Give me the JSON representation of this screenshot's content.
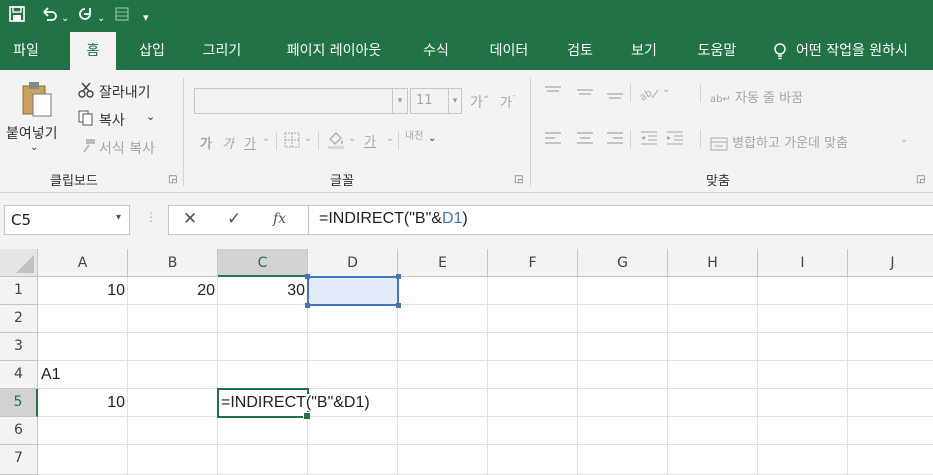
{
  "qat": {
    "save_icon": "save-icon",
    "undo_icon": "undo-icon",
    "redo_icon": "redo-icon",
    "form_icon": "form-icon",
    "customize_icon": "customize-icon"
  },
  "tabs": [
    {
      "label": "파일"
    },
    {
      "label": "홈",
      "active": true
    },
    {
      "label": "삽입"
    },
    {
      "label": "그리기"
    },
    {
      "label": "페이지 레이아웃"
    },
    {
      "label": "수식"
    },
    {
      "label": "데이터"
    },
    {
      "label": "검토"
    },
    {
      "label": "보기"
    },
    {
      "label": "도움말"
    }
  ],
  "tell_me": {
    "placeholder": "어떤 작업을 원하시"
  },
  "clipboard": {
    "paste": "붙여넣기",
    "cut": "잘라내기",
    "copy": "복사",
    "format_painter": "서식 복사",
    "group": "클립보드"
  },
  "font": {
    "font_size": "11",
    "increase": "가",
    "decrease": "가",
    "bold": "가",
    "italic": "가",
    "underline": "가",
    "font_color": "가",
    "phonetic": "내천",
    "group": "글꼴"
  },
  "alignment": {
    "wrap_text": "자동 줄 바꿈",
    "merge_center": "병합하고 가운데 맞춤",
    "group": "맞춤"
  },
  "formula_bar": {
    "name_box": "C5",
    "formula_prefix": "=INDIRECT(\"B\"&",
    "formula_ref": "D1",
    "formula_suffix": ")"
  },
  "columns": [
    "A",
    "B",
    "C",
    "D",
    "E",
    "F",
    "G",
    "H",
    "I",
    "J"
  ],
  "rows": [
    "1",
    "2",
    "3",
    "4",
    "5",
    "6",
    "7"
  ],
  "cells": {
    "A1": "10",
    "B1": "20",
    "C1": "30",
    "A4": "A1",
    "A5": "10",
    "C5": "=INDIRECT(\"B\"&D1)"
  },
  "colors": {
    "accent": "#217346",
    "ref_blue": "#4472c4",
    "header_bg": "#f3f3f3"
  }
}
